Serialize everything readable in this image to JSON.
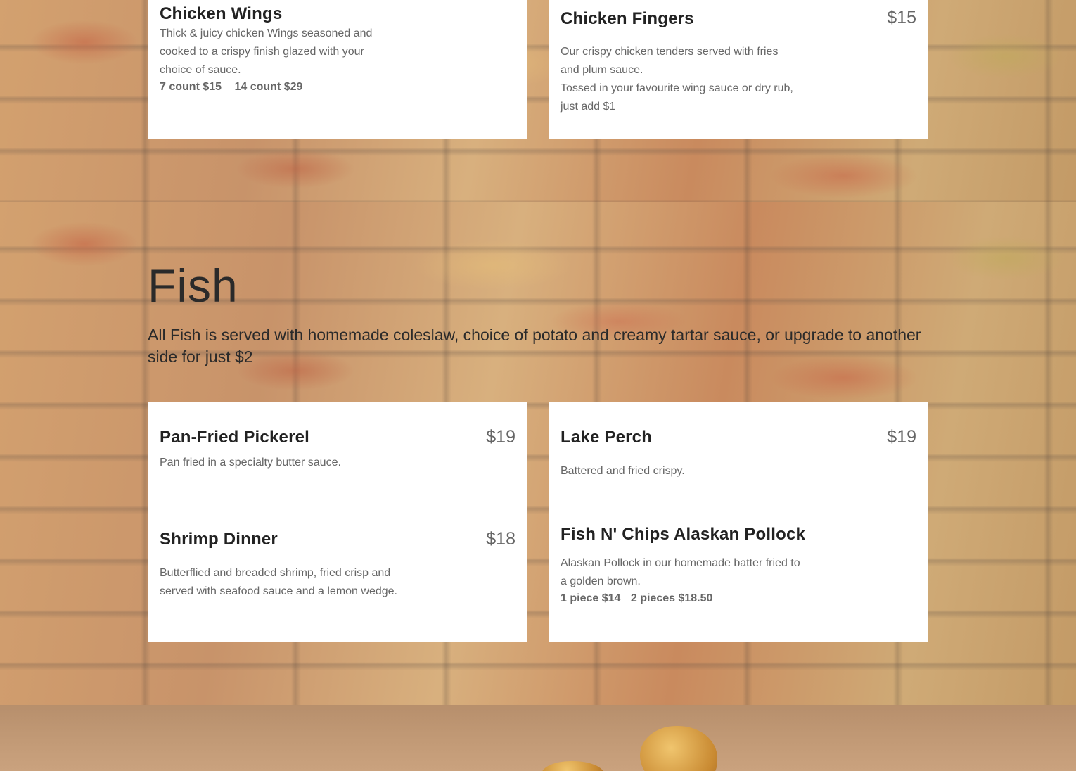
{
  "top_cards": [
    {
      "title": "Chicken Wings",
      "price": "",
      "description": "Thick & juicy chicken Wings seasoned and cooked to a crispy finish glazed with your choice of sauce.",
      "options": [
        "7 count $15",
        "14 count $29"
      ]
    },
    {
      "title": "Chicken Fingers",
      "price": "$15",
      "description": "Our crispy chicken tenders served with fries and plum sauce.",
      "note": "Tossed in your favourite wing sauce or dry rub, just add $1"
    }
  ],
  "fish_section": {
    "title": "Fish",
    "description": "All Fish is served with homemade coleslaw, choice of potato and creamy tartar sauce, or upgrade to another side for just $2",
    "items": [
      {
        "title": "Pan-Fried Pickerel",
        "price": "$19",
        "description": "Pan fried in a specialty butter sauce."
      },
      {
        "title": "Lake Perch",
        "price": "$19",
        "description": "Battered and fried crispy."
      },
      {
        "title": "Shrimp Dinner",
        "price": "$18",
        "description": "Butterflied and breaded shrimp, fried crisp and served with seafood sauce and a lemon wedge."
      },
      {
        "title": "Fish N' Chips Alaskan Pollock",
        "price": "",
        "description": "Alaskan Pollock in our homemade batter fried to a golden brown.",
        "options": [
          "1 piece $14",
          "2 pieces $18.50"
        ]
      }
    ]
  },
  "colors": {
    "card_bg": "#ffffff",
    "title_text": "#222222",
    "body_text": "#666666"
  }
}
